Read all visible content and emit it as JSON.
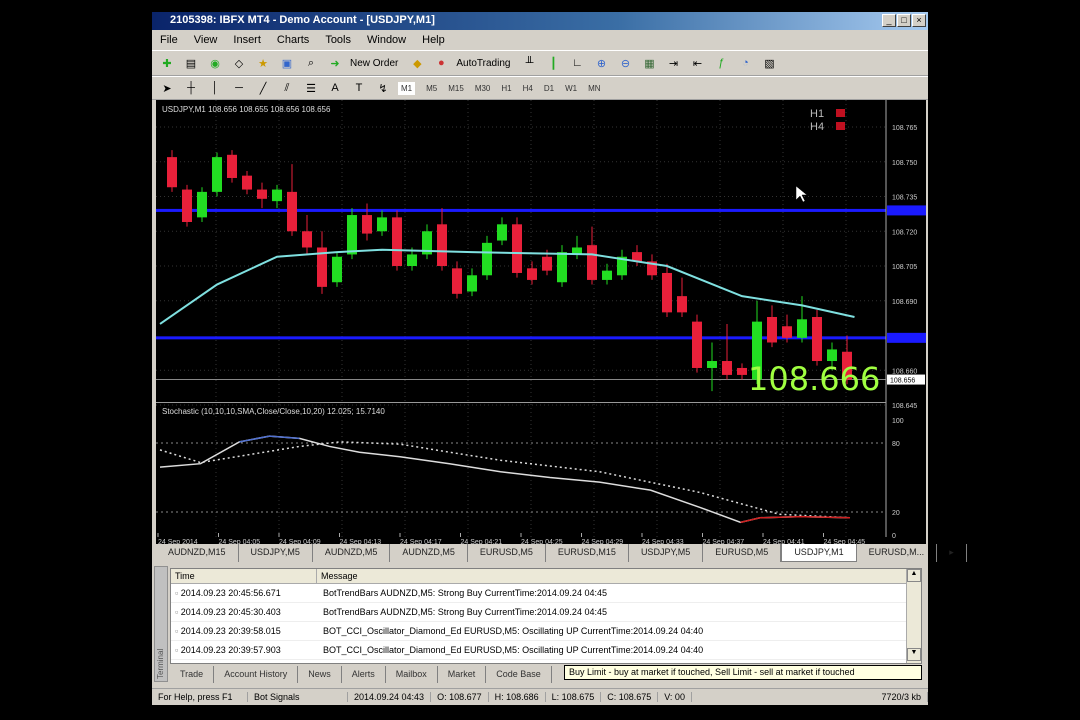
{
  "window": {
    "title": "2105398: IBFX MT4 - Demo Account - [USDJPY,M1]"
  },
  "menu": [
    "File",
    "View",
    "Insert",
    "Charts",
    "Tools",
    "Window",
    "Help"
  ],
  "toolbar": {
    "new_order": "New Order",
    "autotrading": "AutoTrading",
    "timeframes": [
      "M1",
      "M5",
      "M15",
      "M30",
      "H1",
      "H4",
      "D1",
      "W1",
      "MN"
    ]
  },
  "chart": {
    "header": "USDJPY,M1 108.656 108.655 108.656 108.656",
    "legend": [
      "H1",
      "H4"
    ],
    "big_price": "108.666",
    "price_labels": [
      "108.765",
      "108.750",
      "108.735",
      "108.720",
      "108.705",
      "108.690",
      "108.660",
      "108.645"
    ],
    "price_values": [
      108.765,
      108.75,
      108.735,
      108.72,
      108.705,
      108.69,
      108.66,
      108.645
    ],
    "current_price_label": "108.656",
    "current_price": 108.656,
    "hlines": [
      108.729,
      108.674
    ],
    "time_labels": [
      "24 Sep 2014",
      "24 Sep 04:05",
      "24 Sep 04:09",
      "24 Sep 04:13",
      "24 Sep 04:17",
      "24 Sep 04:21",
      "24 Sep 04:25",
      "24 Sep 04:29",
      "24 Sep 04:33",
      "24 Sep 04:37",
      "24 Sep 04:41",
      "24 Sep 04:45"
    ],
    "colors": {
      "bull": "#22dd22",
      "bear": "#e8203a",
      "ma": "#7fe0e0",
      "hline": "#1a1aff",
      "big_price": "#a0ff40"
    },
    "candles": [
      [
        108.752,
        108.755,
        108.737,
        108.739
      ],
      [
        108.738,
        108.74,
        108.722,
        108.724
      ],
      [
        108.726,
        108.739,
        108.724,
        108.737
      ],
      [
        108.737,
        108.754,
        108.735,
        108.752
      ],
      [
        108.753,
        108.755,
        108.741,
        108.743
      ],
      [
        108.744,
        108.746,
        108.736,
        108.738
      ],
      [
        108.738,
        108.741,
        108.73,
        108.734
      ],
      [
        108.733,
        108.74,
        108.73,
        108.738
      ],
      [
        108.737,
        108.749,
        108.718,
        108.72
      ],
      [
        108.72,
        108.727,
        108.71,
        108.713
      ],
      [
        108.713,
        108.72,
        108.693,
        108.696
      ],
      [
        108.698,
        108.711,
        108.696,
        108.709
      ],
      [
        108.71,
        108.73,
        108.708,
        108.727
      ],
      [
        108.727,
        108.732,
        108.716,
        108.719
      ],
      [
        108.72,
        108.729,
        108.718,
        108.726
      ],
      [
        108.726,
        108.729,
        108.703,
        108.705
      ],
      [
        108.705,
        108.713,
        108.703,
        108.71
      ],
      [
        108.71,
        108.723,
        108.708,
        108.72
      ],
      [
        108.723,
        108.73,
        108.703,
        108.705
      ],
      [
        108.704,
        108.707,
        108.691,
        108.693
      ],
      [
        108.694,
        108.704,
        108.692,
        108.701
      ],
      [
        108.701,
        108.718,
        108.699,
        108.715
      ],
      [
        108.716,
        108.726,
        108.714,
        108.723
      ],
      [
        108.723,
        108.726,
        108.7,
        108.702
      ],
      [
        108.704,
        108.707,
        108.697,
        108.699
      ],
      [
        108.709,
        108.712,
        108.701,
        108.703
      ],
      [
        108.698,
        108.714,
        108.696,
        108.711
      ],
      [
        108.71,
        108.718,
        108.708,
        108.713
      ],
      [
        108.714,
        108.722,
        108.697,
        108.699
      ],
      [
        108.699,
        108.706,
        108.697,
        108.703
      ],
      [
        108.701,
        108.712,
        108.699,
        108.709
      ],
      [
        108.711,
        108.714,
        108.705,
        108.707
      ],
      [
        108.707,
        108.71,
        108.699,
        108.701
      ],
      [
        108.702,
        108.706,
        108.683,
        108.685
      ],
      [
        108.692,
        108.7,
        108.683,
        108.685
      ],
      [
        108.681,
        108.684,
        108.659,
        108.661
      ],
      [
        108.661,
        108.672,
        108.651,
        108.664
      ],
      [
        108.664,
        108.68,
        108.656,
        108.658
      ],
      [
        108.661,
        108.663,
        108.656,
        108.658
      ],
      [
        108.656,
        108.69,
        108.654,
        108.681
      ],
      [
        108.683,
        108.688,
        108.67,
        108.672
      ],
      [
        108.679,
        108.684,
        108.672,
        108.674
      ],
      [
        108.674,
        108.692,
        108.672,
        108.682
      ],
      [
        108.683,
        108.686,
        108.662,
        108.664
      ],
      [
        108.664,
        108.672,
        108.66,
        108.669
      ],
      [
        108.668,
        108.675,
        108.654,
        108.656
      ]
    ],
    "ma": [
      [
        -0.8,
        108.68
      ],
      [
        3,
        108.697
      ],
      [
        7,
        108.709
      ],
      [
        11,
        108.711
      ],
      [
        14,
        108.712
      ],
      [
        20,
        108.711
      ],
      [
        28,
        108.71
      ],
      [
        33,
        108.705
      ],
      [
        38,
        108.692
      ],
      [
        42,
        108.688
      ],
      [
        45.5,
        108.683
      ]
    ]
  },
  "stochastic": {
    "title": "Stochastic (10,10,10,SMA,Close/Close,10,20) 12.025; 15.7140",
    "levels": [
      100,
      80,
      20,
      0
    ],
    "level_labels": [
      "100",
      "80",
      "20",
      "0"
    ],
    "main": [
      [
        -0.8,
        59
      ],
      [
        1.9,
        62
      ],
      [
        4.5,
        81
      ],
      [
        6.5,
        86
      ],
      [
        8.5,
        84
      ],
      [
        10.5,
        77
      ],
      [
        12.5,
        72
      ],
      [
        15.2,
        68
      ],
      [
        18.5,
        62
      ],
      [
        21.9,
        55
      ],
      [
        25.2,
        50
      ],
      [
        28.5,
        46
      ],
      [
        31.9,
        39
      ],
      [
        35.2,
        24
      ],
      [
        37.9,
        11
      ],
      [
        39.2,
        15
      ],
      [
        41.9,
        16
      ],
      [
        45.2,
        15
      ]
    ],
    "signal": [
      [
        -0.8,
        74
      ],
      [
        1.9,
        63
      ],
      [
        5.2,
        70
      ],
      [
        8.5,
        77
      ],
      [
        11.2,
        81
      ],
      [
        15.2,
        79
      ],
      [
        18.5,
        72
      ],
      [
        21.9,
        65
      ],
      [
        28.5,
        55
      ],
      [
        35.2,
        37
      ],
      [
        40.5,
        18
      ],
      [
        45.2,
        15
      ]
    ]
  },
  "chart_tabs": [
    "AUDNZD,M15",
    "USDJPY,M5",
    "AUDNZD,M5",
    "AUDNZD,M5",
    "EURUSD,M5",
    "EURUSD,M15",
    "USDJPY,M5",
    "EURUSD,M5",
    "USDJPY,M1",
    "EURUSD,M..."
  ],
  "terminal": {
    "side_label": "Terminal",
    "columns": [
      "Time",
      "Message"
    ],
    "rows": [
      {
        "time": "2014.09.23 20:45:56.671",
        "message": "BotTrendBars AUDNZD,M5: Strong Buy CurrentTime:2014.09.24 04:45"
      },
      {
        "time": "2014.09.23 20:45:30.403",
        "message": "BotTrendBars AUDNZD,M5: Strong Buy CurrentTime:2014.09.24 04:45"
      },
      {
        "time": "2014.09.23 20:39:58.015",
        "message": "BOT_CCI_Oscillator_Diamond_Ed EURUSD,M5: Oscillating UP CurrentTime:2014.09.24 04:40"
      },
      {
        "time": "2014.09.23 20:39:57.903",
        "message": "BOT_CCI_Oscillator_Diamond_Ed EURUSD,M5: Oscillating UP CurrentTime:2014.09.24 04:40"
      }
    ],
    "tabs": [
      "Trade",
      "Account History",
      "News",
      "Alerts",
      "Mailbox",
      "Market",
      "Code Base"
    ],
    "tooltip": "Buy Limit - buy at market if touched, Sell Limit - sell at market if touched"
  },
  "status": [
    "For Help, press F1",
    "Bot Signals",
    "2014.09.24 04:43",
    "O: 108.677",
    "H: 108.686",
    "L: 108.675",
    "C: 108.675",
    "V: 00",
    "7720/3 kb"
  ]
}
